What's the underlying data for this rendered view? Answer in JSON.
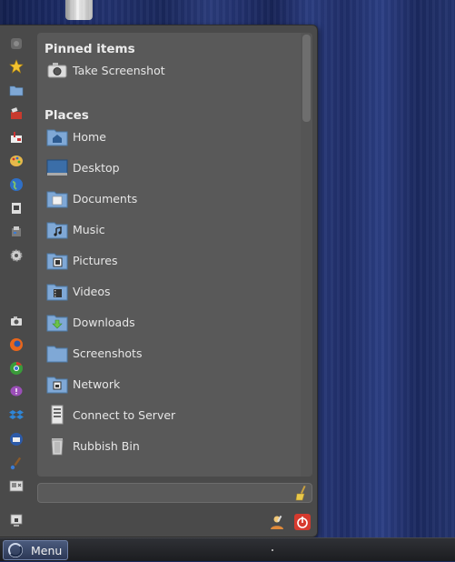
{
  "pinned": {
    "title": "Pinned items",
    "items": [
      {
        "label": "Take Screenshot",
        "icon": "camera-icon"
      }
    ]
  },
  "places": {
    "title": "Places",
    "items": [
      {
        "label": "Home",
        "icon": "home-folder-icon"
      },
      {
        "label": "Desktop",
        "icon": "desktop-icon"
      },
      {
        "label": "Documents",
        "icon": "documents-folder-icon"
      },
      {
        "label": "Music",
        "icon": "music-folder-icon"
      },
      {
        "label": "Pictures",
        "icon": "pictures-folder-icon"
      },
      {
        "label": "Videos",
        "icon": "videos-folder-icon"
      },
      {
        "label": "Downloads",
        "icon": "downloads-folder-icon"
      },
      {
        "label": "Screenshots",
        "icon": "folder-icon"
      },
      {
        "label": "Network",
        "icon": "network-folder-icon"
      },
      {
        "label": "Connect to Server",
        "icon": "server-icon"
      },
      {
        "label": "Rubbish Bin",
        "icon": "trash-icon"
      }
    ]
  },
  "search": {
    "value": "",
    "placeholder": ""
  },
  "sidebar": {
    "icons": [
      "menu-icon",
      "star-icon",
      "folder-icon",
      "toolbox-icon",
      "terminal-icon",
      "palette-icon",
      "globe-icon",
      "office-icon",
      "printer-icon",
      "settings-gear-icon",
      "camera-icon",
      "firefox-icon",
      "chrome-icon",
      "chat-icon",
      "dropbox-icon",
      "thunderbird-icon",
      "paintbrush-icon",
      "display-settings-icon",
      "lock-screen-icon"
    ]
  },
  "taskbar": {
    "menu_label": "Menu"
  },
  "colors": {
    "accent": "#7fa8d6",
    "panel": "#595959",
    "menu_bg": "#4a4a4a"
  }
}
